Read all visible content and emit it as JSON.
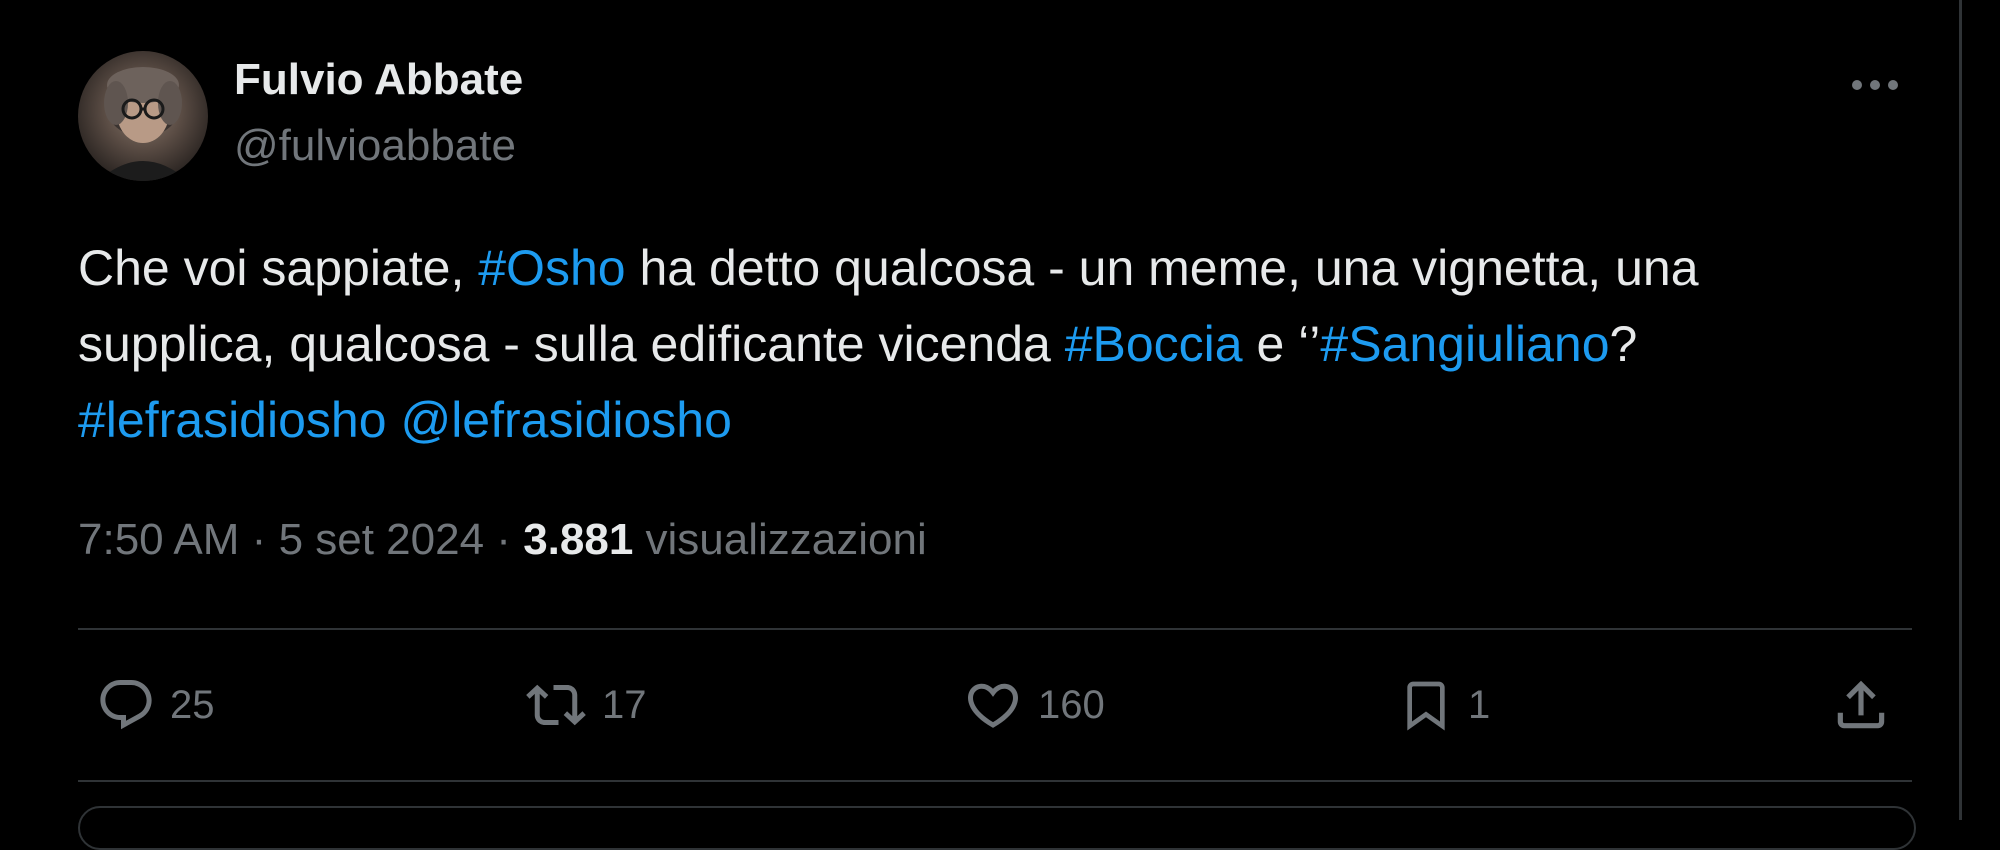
{
  "author": {
    "name": "Fulvio Abbate",
    "handle": "@fulvioabbate"
  },
  "tweet": {
    "segments": [
      {
        "text": "Che voi sappiate, ",
        "type": "text"
      },
      {
        "text": "#Osho",
        "type": "link"
      },
      {
        "text": " ha detto qualcosa - un meme, una vignetta, una supplica, qualcosa - sulla edificante vicenda ",
        "type": "text"
      },
      {
        "text": "#Boccia",
        "type": "link"
      },
      {
        "text": " e ‘’",
        "type": "text"
      },
      {
        "text": "#Sangiuliano",
        "type": "link"
      },
      {
        "text": "? ",
        "type": "text"
      },
      {
        "text": "#lefrasidiosho",
        "type": "link"
      },
      {
        "text": " ",
        "type": "text"
      },
      {
        "text": "@lefrasidiosho",
        "type": "link"
      }
    ],
    "time": "7:50 AM",
    "separator": "·",
    "date": "5 set 2024",
    "views_count": "3.881",
    "views_label": "visualizzazioni"
  },
  "actions": {
    "replies": "25",
    "reposts": "17",
    "likes": "160",
    "bookmarks": "1"
  },
  "colors": {
    "background": "#000000",
    "text": "#e7e9ea",
    "secondary": "#71767b",
    "link": "#1d9bf0",
    "border": "#2f3336"
  },
  "icons": [
    "more-icon",
    "reply-icon",
    "repost-icon",
    "like-icon",
    "bookmark-icon",
    "share-icon"
  ]
}
